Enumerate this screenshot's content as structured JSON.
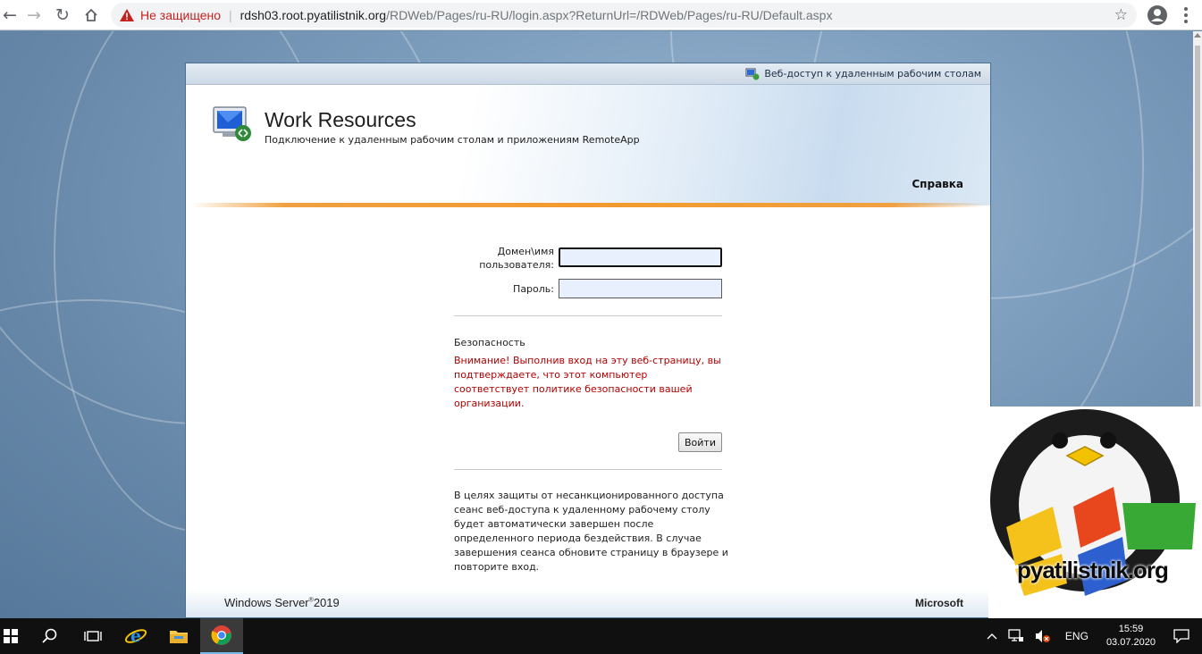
{
  "browser": {
    "security_label": "Не защищено",
    "url_host": "rdsh03.root.pyatilistnik.org",
    "url_path": "/RDWeb/Pages/ru-RU/login.aspx?ReturnUrl=/RDWeb/Pages/ru-RU/Default.aspx"
  },
  "panel": {
    "topbar_label": "Веб-доступ к удаленным рабочим столам",
    "title": "Work Resources",
    "subtitle": "Подключение к удаленным рабочим столам и приложениям RemoteApp",
    "help_link": "Справка"
  },
  "form": {
    "username_label_line1": "Домен\\имя",
    "username_label_line2": "пользователя:",
    "username_value": "",
    "password_label": "Пароль:",
    "password_value": "",
    "security_title": "Безопасность",
    "security_warning": "Внимание! Выполнив вход на эту веб-страницу, вы подтверждаете, что этот компьютер соответствует политике безопасности вашей организации.",
    "login_button": "Войти",
    "timeout_note": "В целях защиты от несанкционированного доступа сеанс веб-доступа к удаленному рабочему столу будет автоматически завершен после определенного периода бездействия. В случае завершения сеанса обновите страницу в браузере и повторите вход."
  },
  "footer": {
    "product": "Windows Server",
    "product_version": "2019",
    "vendor": "Microsoft"
  },
  "watermark": {
    "text": "pyatilistnik.org"
  },
  "taskbar": {
    "language": "ENG",
    "time": "15:59",
    "date": "03.07.2020"
  },
  "colors": {
    "accent_orange": "#f29a2e",
    "warning_red": "#b00000",
    "chrome_insecure": "#c5221f"
  }
}
